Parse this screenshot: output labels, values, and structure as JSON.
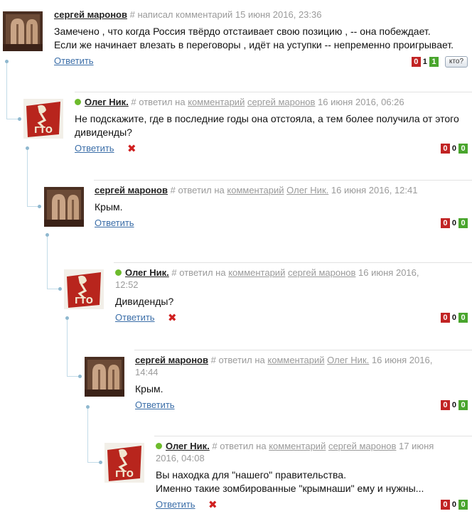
{
  "comments": [
    {
      "author": "сергей маронов",
      "hash": "#",
      "action": "написал комментарий",
      "date": "15 июня 2016, 23:36",
      "text_lines": [
        "Замечено , что когда Россия твёрдо отстаивает свою позицию , -- она побеждает.",
        "Если же начинает влезать в переговоры , идёт на уступки -- непременно проигрывает."
      ],
      "reply_label": "Ответить",
      "votes": {
        "minus": "0",
        "count": "1",
        "plus": "1"
      },
      "who_label": "кто?"
    },
    {
      "author": "Олег Ник.",
      "hash": "#",
      "action": "ответил на",
      "ref_comment": "комментарий",
      "ref_author": "сергей маронов",
      "date": "16 июня 2016, 06:26",
      "text_lines": [
        "Не подскажите, где в последние годы она отстояла, а тем более получила от этого",
        "дивиденды?"
      ],
      "reply_label": "Ответить",
      "delete_icon": "✖",
      "votes": {
        "minus": "0",
        "count": "0",
        "plus": "0"
      }
    },
    {
      "author": "сергей маронов",
      "hash": "#",
      "action": "ответил на",
      "ref_comment": "комментарий",
      "ref_author": "Олег Ник.",
      "date": "16 июня 2016, 12:41",
      "text_lines": [
        "Крым."
      ],
      "reply_label": "Ответить",
      "votes": {
        "minus": "0",
        "count": "0",
        "plus": "0"
      }
    },
    {
      "author": "Олег Ник.",
      "hash": "#",
      "action": "ответил на",
      "ref_comment": "комментарий",
      "ref_author": "сергей маронов",
      "date": "16 июня 2016,",
      "date_line2": "12:52",
      "text_lines": [
        "Дивиденды?"
      ],
      "reply_label": "Ответить",
      "delete_icon": "✖",
      "votes": {
        "minus": "0",
        "count": "0",
        "plus": "0"
      }
    },
    {
      "author": "сергей маронов",
      "hash": "#",
      "action": "ответил на",
      "ref_comment": "комментарий",
      "ref_author": "Олег Ник.",
      "date": "16 июня 2016,",
      "date_line2": "14:44",
      "text_lines": [
        "Крым."
      ],
      "reply_label": "Ответить",
      "votes": {
        "minus": "0",
        "count": "0",
        "plus": "0"
      }
    },
    {
      "author": "Олег Ник.",
      "hash": "#",
      "action": "ответил на",
      "ref_comment": "комментарий",
      "ref_author": "сергей маронов",
      "date": "17 июня",
      "date_line2": "2016, 04:08",
      "text_lines": [
        "Вы находка для \"нашего\" правительства.",
        "Именно такие зомбированные \"крымнаши\" ему и нужны..."
      ],
      "reply_label": "Ответить",
      "delete_icon": "✖",
      "votes": {
        "minus": "0",
        "count": "0",
        "plus": "0"
      }
    }
  ]
}
